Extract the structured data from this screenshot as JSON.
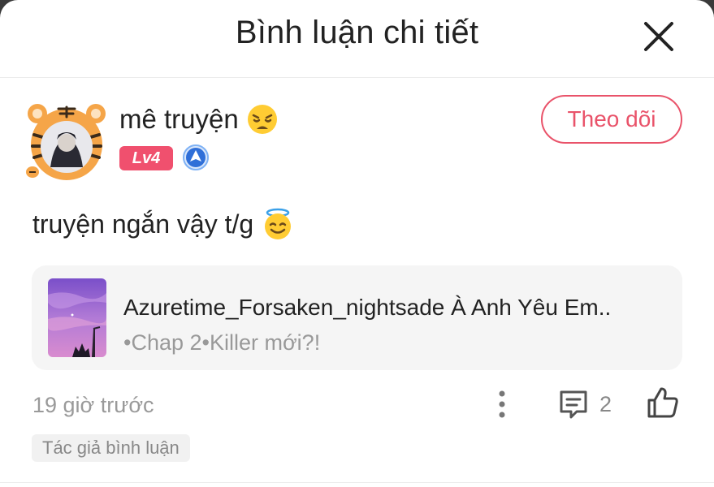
{
  "header": {
    "title": "Bình luận chi tiết",
    "close_icon": "close-icon"
  },
  "comment": {
    "user": {
      "name": "mê truyện",
      "name_emoji": "weary-face-emoji",
      "level": "Lv4",
      "rank_icon": "blue-rank-badge-icon",
      "avatar": "tiger-frame-avatar"
    },
    "follow_label": "Theo dõi",
    "text": "truyện ngắn vậy t/g",
    "text_emoji": "smiling-face-with-halo-emoji",
    "story": {
      "title": "Azuretime_Forsaken_nightsade À Anh Yêu Em..",
      "chapter": "•Chap 2•Killer mới?!"
    },
    "timestamp": "19 giờ trước",
    "reply_count": "2",
    "author_tag": "Tác giả bình luận"
  },
  "colors": {
    "accent": "#e9536a",
    "level_badge": "#f0506e",
    "muted_text": "#999999",
    "card_bg": "#f5f5f5"
  }
}
